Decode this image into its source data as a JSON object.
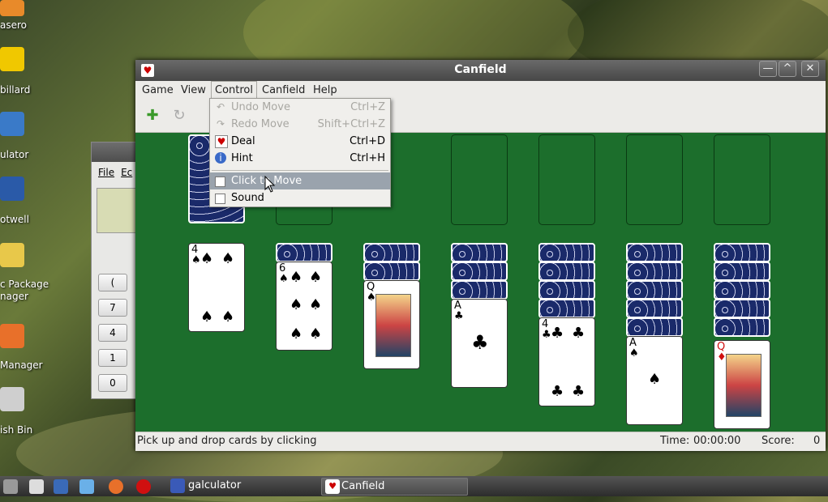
{
  "desktop": {
    "icons": [
      {
        "label": "asero",
        "icon": "disc-burner-icon"
      },
      {
        "label": "billard",
        "icon": "billiards-icon"
      },
      {
        "label": "ulator",
        "icon": "calculator-icon"
      },
      {
        "label": "otwell",
        "icon": "photo-icon"
      },
      {
        "label": "c Package",
        "label2": "nager",
        "icon": "package-icon"
      },
      {
        "label": "Manager",
        "icon": "update-icon"
      },
      {
        "label": "ish Bin",
        "icon": "trash-icon"
      }
    ]
  },
  "galculator": {
    "menu": [
      "File",
      "Ec"
    ],
    "keys": [
      "(",
      "7",
      "4",
      "1",
      "0"
    ]
  },
  "window": {
    "title": "Canfield",
    "minimize": "—",
    "maximize": "^",
    "close": "✕",
    "menus": [
      "Game",
      "View",
      "Control",
      "Canfield",
      "Help"
    ]
  },
  "control_menu": {
    "items": [
      {
        "label": "Undo Move",
        "shortcut": "Ctrl+Z",
        "icon": "undo-icon"
      },
      {
        "label": "Redo Move",
        "shortcut": "Shift+Ctrl+Z",
        "icon": "redo-icon"
      },
      {
        "label": "Deal",
        "shortcut": "Ctrl+D",
        "icon": "deal-icon"
      },
      {
        "label": "Hint",
        "shortcut": "Ctrl+H",
        "icon": "info-icon"
      },
      {
        "label": "Click to Move",
        "shortcut": "",
        "icon": "checkbox"
      },
      {
        "label": "Sound",
        "shortcut": "",
        "icon": "checkbox"
      }
    ]
  },
  "tableau": [
    {
      "rank": "4",
      "suit": "♠",
      "backs": 0
    },
    {
      "rank": "6",
      "suit": "♠",
      "backs": 1
    },
    {
      "rank": "Q",
      "suit": "♠",
      "backs": 2
    },
    {
      "rank": "A",
      "suit": "♣",
      "backs": 3
    },
    {
      "rank": "4",
      "suit": "♣",
      "backs": 4
    },
    {
      "rank": "A",
      "suit": "♠",
      "backs": 5
    },
    {
      "rank": "Q",
      "suit": "♦",
      "backs": 6
    }
  ],
  "status": {
    "message": "Pick up and drop cards by clicking",
    "time_label": "Time:",
    "time_value": "00:00:00",
    "score_label": "Score:",
    "score_value": "0"
  },
  "taskbar": {
    "tasks": [
      "galculator",
      "Canfield"
    ]
  }
}
